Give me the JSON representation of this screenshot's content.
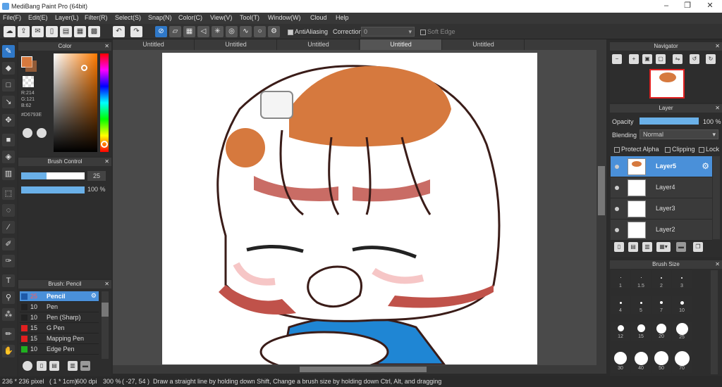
{
  "app": {
    "title": "MediBang Paint Pro (64bit)",
    "minimize": "–",
    "maximize": "❐",
    "close": "✕"
  },
  "menu": [
    "File(F)",
    "Edit(E)",
    "Layer(L)",
    "Filter(R)",
    "Select(S)",
    "Snap(N)",
    "Color(C)",
    "View(V)",
    "Tool(T)",
    "Window(W)",
    "Cloud",
    "Help"
  ],
  "toolbar": {
    "antialiasing": "AntiAliasing",
    "correction": "Correction",
    "correction_value": "0",
    "soft_edge": "Soft Edge"
  },
  "tabs": [
    "Untitled",
    "Untitled",
    "Untitled",
    "Untitled",
    "Untitled"
  ],
  "color_panel": {
    "title": "Color",
    "r": "R:214",
    "g": "G:121",
    "b": "B:62",
    "hex": "#D6793E",
    "fg": "#D6793E"
  },
  "brush_control": {
    "title": "Brush Control",
    "size": "25",
    "opacity": "100 %"
  },
  "brush_panel": {
    "title": "Brush: Pencil",
    "items": [
      {
        "size": "25",
        "name": "Pencil",
        "color": "#1e5aa8"
      },
      {
        "size": "10",
        "name": "Pen",
        "color": "#222222"
      },
      {
        "size": "10",
        "name": "Pen (Sharp)",
        "color": "#222222"
      },
      {
        "size": "15",
        "name": "G Pen",
        "color": "#e02020"
      },
      {
        "size": "15",
        "name": "Mapping Pen",
        "color": "#e02020"
      },
      {
        "size": "10",
        "name": "Edge Pen",
        "color": "#20b020"
      }
    ]
  },
  "navigator": {
    "title": "Navigator"
  },
  "layer_panel": {
    "title": "Layer",
    "opacity_label": "Opacity",
    "opacity_value": "100 %",
    "blending_label": "Blending",
    "blending_value": "Normal",
    "protect_alpha": "Protect Alpha",
    "clipping": "Clipping",
    "lock": "Lock",
    "layers": [
      "Layer5",
      "Layer4",
      "Layer3",
      "Layer2"
    ]
  },
  "brush_size": {
    "title": "Brush Size",
    "sizes": [
      "1",
      "1.5",
      "2",
      "3",
      "4",
      "5",
      "7",
      "10",
      "12",
      "15",
      "20",
      "25",
      "30",
      "40",
      "50",
      "70"
    ]
  },
  "status": {
    "size": "236 * 236 pixel",
    "unit": "( 1 * 1cm)",
    "dpi": "600 dpi",
    "zoom": "300 %",
    "coords": "( -27, 54 )",
    "hint": "Draw a straight line by holding down Shift, Change a brush size by holding down Ctrl, Alt, and dragging"
  }
}
